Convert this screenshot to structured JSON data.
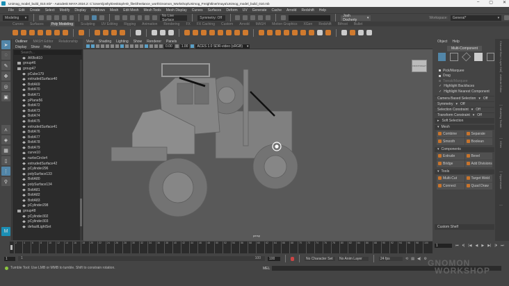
{
  "title": "Unimog_model_build_010.mb* - Autodesk MAYA 2024.2: C:\\Users\\joshy\\Desktop\\HD_files\\freelance_work\\Gnomon_Workshop\\Unimog_Freightliner\\maya\\Unimog_model_build_010.mb",
  "window_buttons": [
    "–",
    "▢",
    "✕"
  ],
  "menu": [
    "File",
    "Edit",
    "Create",
    "Select",
    "Modify",
    "Display",
    "Windows",
    "Mesh",
    "Edit Mesh",
    "Mesh Tools",
    "Mesh Display",
    "Curves",
    "Surfaces",
    "Deform",
    "UV",
    "Generate",
    "Cache",
    "Arnold",
    "Redshift",
    "Help"
  ],
  "status": {
    "mode": "Modeling",
    "live_surface": "No Live Surface",
    "symmetry": "Symmetry: Off",
    "user": "Josh Docherty",
    "workspace_label": "Workspace:",
    "workspace": "General*"
  },
  "shelf_tabs": [
    "Curves",
    "Surfaces",
    "Poly Modeling",
    "Sculpting",
    "UV Editing",
    "Rigging",
    "Animation",
    "Rendering",
    "FX",
    "FX Caching",
    "Custom",
    "Arnold",
    "MASH",
    "Motion Graphics",
    "XGen",
    "Redshift",
    "Bifrost",
    "Bullet"
  ],
  "outliner": {
    "tabs": [
      "Outliner",
      "MASH Editor",
      "Relationship"
    ],
    "menu": [
      "Display",
      "Show",
      "Help"
    ],
    "search_placeholder": "Search...",
    "items": [
      {
        "n": "AKBolt10",
        "t": "m"
      },
      {
        "n": "group46",
        "t": "g"
      },
      {
        "n": "group47",
        "t": "g"
      },
      {
        "n": "pCube179",
        "t": "m"
      },
      {
        "n": "extrudedSurface40",
        "t": "m"
      },
      {
        "n": "BoltA69",
        "t": "m"
      },
      {
        "n": "BoltA70",
        "t": "m"
      },
      {
        "n": "BoltA71",
        "t": "m"
      },
      {
        "n": "pPlane56",
        "t": "m"
      },
      {
        "n": "BoltA72",
        "t": "m"
      },
      {
        "n": "BoltA73",
        "t": "m"
      },
      {
        "n": "BoltA74",
        "t": "m"
      },
      {
        "n": "BoltA75",
        "t": "m"
      },
      {
        "n": "extrudedSurface41",
        "t": "m"
      },
      {
        "n": "BoltA76",
        "t": "m"
      },
      {
        "n": "BoltA77",
        "t": "m"
      },
      {
        "n": "BoltA78",
        "t": "m"
      },
      {
        "n": "BoltA79",
        "t": "m"
      },
      {
        "n": "curve10",
        "t": "m"
      },
      {
        "n": "nurbsCircle4",
        "t": "m"
      },
      {
        "n": "extrudedSurface42",
        "t": "m"
      },
      {
        "n": "pCylinder296",
        "t": "m"
      },
      {
        "n": "polySurface133",
        "t": "m"
      },
      {
        "n": "BoltA80",
        "t": "m"
      },
      {
        "n": "polySurface134",
        "t": "m"
      },
      {
        "n": "BoltA81",
        "t": "m"
      },
      {
        "n": "BoltA82",
        "t": "m"
      },
      {
        "n": "BoltA83",
        "t": "m"
      },
      {
        "n": "pCylinder298",
        "t": "m"
      },
      {
        "n": "group48",
        "t": "g"
      },
      {
        "n": "pCylinder302",
        "t": "m"
      },
      {
        "n": "pCylinder303",
        "t": "m"
      },
      {
        "n": "defaultLightSet",
        "t": "m"
      }
    ]
  },
  "viewport": {
    "menu": [
      "View",
      "Shading",
      "Lighting",
      "Show",
      "Renderer",
      "Panels"
    ],
    "exposure": "0.00",
    "gamma": "1.00",
    "color_space": "ACES 1.0 SDR-video (sRGB)",
    "camera": "persp",
    "viewcube": [
      "FRONT",
      "RIGHT"
    ]
  },
  "toolkit": {
    "menu": [
      "Object",
      "Help"
    ],
    "mode": "Multi-Component",
    "pick_options": [
      {
        "label": "Pick/Marquee",
        "dim": false
      },
      {
        "label": "Drag",
        "dim": false
      },
      {
        "label": "Tweak/Marquee",
        "dim": true
      }
    ],
    "checks": [
      "Highlight Backfaces",
      "Highlight Nearest Component"
    ],
    "rows": [
      {
        "label": "Camera Based Selection",
        "value": "Off"
      },
      {
        "label": "Symmetry",
        "value": "Off"
      },
      {
        "label": "Selection Constraint",
        "value": "Off"
      },
      {
        "label": "Transform Constraint",
        "value": "Off"
      }
    ],
    "soft": "Soft Selection",
    "sections": [
      {
        "title": "Mesh",
        "buttons": [
          "Combine",
          "Separate",
          "Smooth",
          "Boolean"
        ]
      },
      {
        "title": "Components",
        "buttons": [
          "Extrude",
          "Bevel",
          "Bridge",
          "Add Divisions"
        ]
      },
      {
        "title": "Tools",
        "buttons": [
          "Multi-Cut",
          "Target Weld",
          "Connect",
          "Quad Draw"
        ]
      }
    ],
    "custom_shelf": "Custom Shelf"
  },
  "side_tabs": [
    "Channel Box / Layer Editor",
    "Attribute Editor",
    "Modeling Toolkit",
    "XGen",
    "Hypershade"
  ],
  "timeline": {
    "ticks": [
      "2",
      "4",
      "6",
      "8",
      "10",
      "12",
      "14",
      "16",
      "18",
      "20",
      "22",
      "24",
      "26",
      "28",
      "30",
      "32",
      "34",
      "36",
      "38",
      "40",
      "42",
      "44",
      "46",
      "48",
      "50",
      "52",
      "54",
      "56",
      "58",
      "60",
      "62",
      "64",
      "66",
      "68",
      "70",
      "72",
      "74",
      "76",
      "78",
      "80",
      "82",
      "84",
      "86",
      "88",
      "90",
      "92",
      "94",
      "96",
      "98",
      "100"
    ],
    "current_frame": "1",
    "playback": [
      "⏮",
      "⏴|",
      "|◀",
      "◀",
      "▶",
      "▶|",
      "|⏵",
      "⏭"
    ]
  },
  "range": {
    "start": "1",
    "inner_start": "1",
    "inner_end": "100",
    "end": "100",
    "character_set": "No Character Set",
    "anim_layer": "No Anim Layer",
    "fps": "24 fps"
  },
  "help_line": "Tumble Tool: Use LMB or MMB to tumble. Shift to constrain rotation.",
  "mel_label": "MEL",
  "watermark": [
    "GNOMON",
    "WORKSHOP"
  ]
}
